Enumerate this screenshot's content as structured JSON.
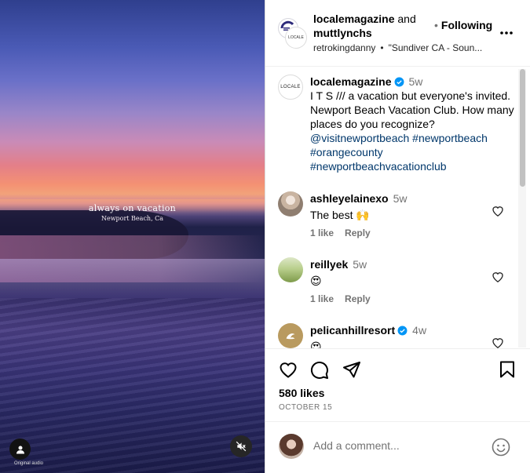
{
  "media": {
    "overlay_title": "always on vacation",
    "overlay_subtitle": "Newport Beach, Ca",
    "audio_credit": "Original audio"
  },
  "header": {
    "author": "localemagazine",
    "and": " and",
    "coauthor": "muttlynchs",
    "follow_label": "Following",
    "audio_user": "retrokingdanny",
    "audio_track": "\"Sundiver CA - Soun..."
  },
  "caption": {
    "username": "localemagazine",
    "time": "5w",
    "text": "I T S /// a vacation but everyone's invited. Newport Beach Vacation Club. How many places do you recognize?",
    "tags": [
      "@visitnewportbeach",
      "#newportbeach",
      "#orangecounty",
      "#newportbeachvacationclub"
    ],
    "avatar_text": "LOCALE"
  },
  "comments": [
    {
      "username": "ashleyelainexo",
      "verified": false,
      "time": "5w",
      "text": "The best 🙌",
      "likes": "1 like",
      "reply": "Reply"
    },
    {
      "username": "reillyek",
      "verified": false,
      "time": "5w",
      "text": "😍",
      "likes": "1 like",
      "reply": "Reply"
    },
    {
      "username": "pelicanhillresort",
      "verified": true,
      "time": "4w",
      "text": "😍",
      "likes": "",
      "reply": ""
    }
  ],
  "actions": {
    "likes": "580 likes",
    "date": "OCTOBER 15"
  },
  "add_comment": {
    "placeholder": "Add a comment..."
  },
  "colors": {
    "verified": "#0095f6",
    "link": "#00376b",
    "muted": "#737373"
  },
  "icons": [
    "heart-icon",
    "comment-icon",
    "share-icon",
    "bookmark-icon",
    "more-icon",
    "mute-icon",
    "user-icon",
    "emoji-icon",
    "verified-icon"
  ]
}
